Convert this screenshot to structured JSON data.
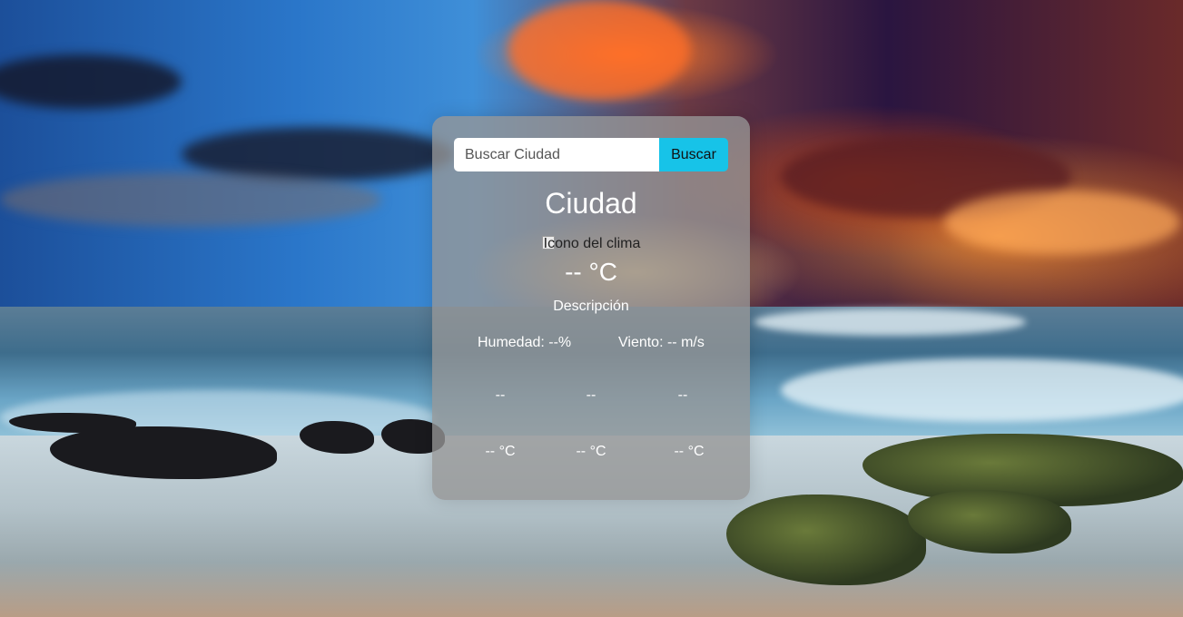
{
  "search": {
    "placeholder": "Buscar Ciudad",
    "button_label": "Buscar"
  },
  "weather": {
    "city": "Ciudad",
    "icon_alt": "Icono del clima",
    "temperature": "-- °C",
    "description": "Descripción",
    "humidity": "Humedad: --%",
    "wind": "Viento: -- m/s"
  },
  "forecast": {
    "days": [
      "--",
      "--",
      "--"
    ],
    "temps": [
      "-- °C",
      "-- °C",
      "-- °C"
    ]
  },
  "colors": {
    "button": "#17c3e8",
    "card": "rgba(150,150,150,0.78)"
  }
}
